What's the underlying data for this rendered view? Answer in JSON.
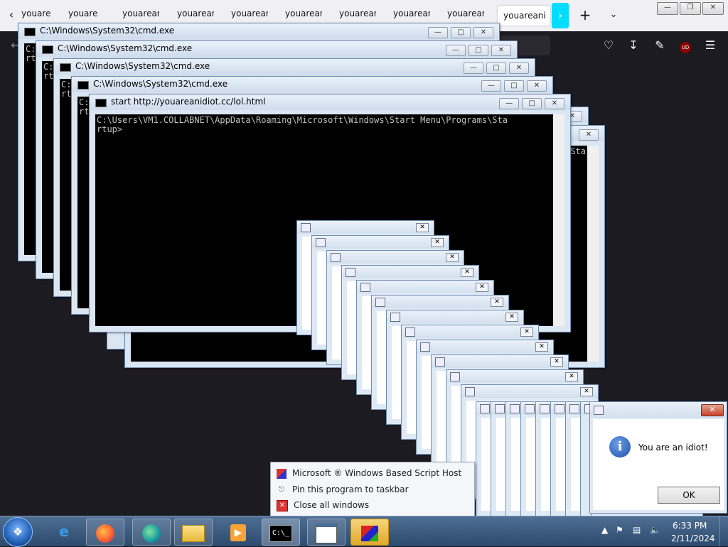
{
  "firefox": {
    "tabs": [
      "youareani",
      "youareani",
      "youareani",
      "youareani",
      "youareani",
      "youareani",
      "youareani",
      "youareani",
      "youareani"
    ],
    "active_tab": "youareani",
    "icons": [
      "back-icon",
      "scroll-right-icon",
      "new-tab-icon",
      "tab-list-icon",
      "pocket-icon",
      "download-icon",
      "extensions-icon",
      "ublock-icon",
      "menu-icon"
    ],
    "ublock_label": "UD"
  },
  "outer_window_controls": [
    "minimize",
    "restore",
    "close"
  ],
  "cmd_windows": [
    {
      "title": "C:\\Windows\\System32\\cmd.exe",
      "body": "C:\nrt"
    },
    {
      "title": "C:\\Windows\\System32\\cmd.exe",
      "body": "C:\nrt"
    },
    {
      "title": "C:\\Windows\\System32\\cmd.exe",
      "body": "C:\nrt"
    },
    {
      "title": "C:\\Windows\\System32\\cmd.exe",
      "body": "C:\nrt"
    },
    {
      "title": "start  http://youareanidiot.cc/lol.html",
      "body": "C:\\Users\\VM1.COLLABNET\\AppData\\Roaming\\Microsoft\\Windows\\Start Menu\\Programs\\Sta\nrtup>"
    }
  ],
  "back_cmd_text": "Sta",
  "dialog": {
    "message": "You are an idiot!",
    "ok_label": "OK",
    "close_label": "✕"
  },
  "jumplist": {
    "items": [
      {
        "label": "Microsoft ® Windows Based Script Host",
        "icon": "script-host-icon"
      },
      {
        "label": "Pin this program to taskbar",
        "icon": "pin-icon"
      },
      {
        "label": "Close all windows",
        "icon": "close-all-icon"
      }
    ]
  },
  "taskbar": {
    "apps": [
      "internet-explorer-icon",
      "firefox-icon",
      "edge-icon",
      "file-explorer-icon",
      "media-player-icon",
      "cmd-icon",
      "window-icon",
      "script-host-icon"
    ],
    "time": "6:33 PM",
    "date": "2/11/2024"
  }
}
